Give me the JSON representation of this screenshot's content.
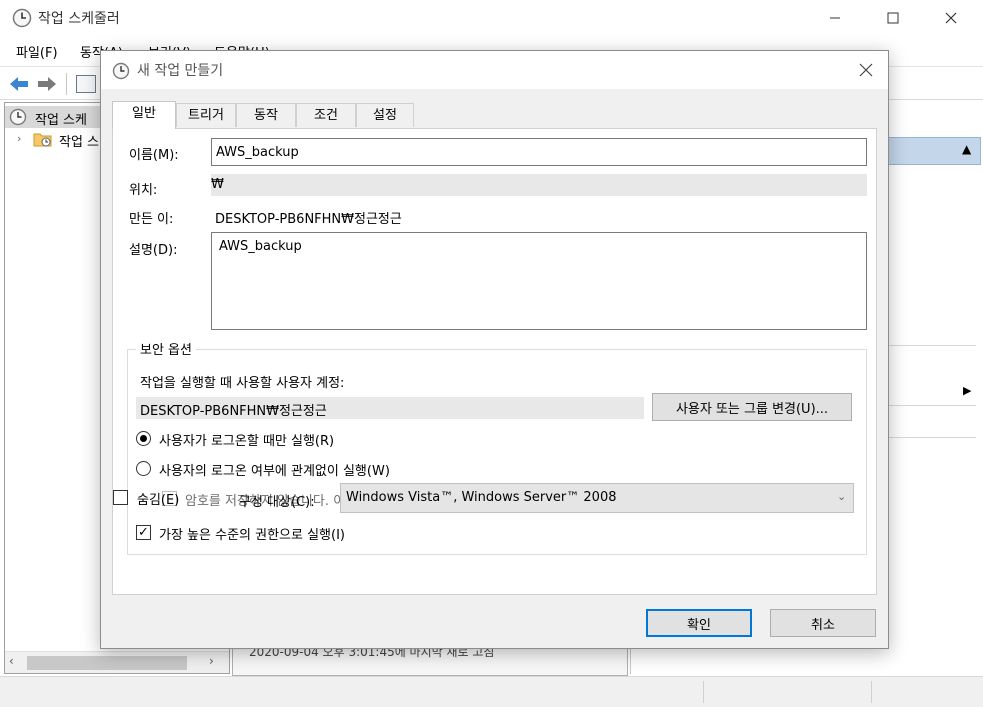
{
  "main_window": {
    "title": "작업 스케줄러",
    "menu": [
      "파일(F)",
      "동작(A)",
      "보기(V)",
      "도움말(H)"
    ],
    "tree": {
      "root_label": "작업 스케",
      "child_label": "작업 스"
    },
    "middle_bottom_text": "2020-09-04 오후 3:01:45에 마지막 새로 고침"
  },
  "dialog": {
    "title": "새 작업 만들기",
    "tabs": [
      "일반",
      "트리거",
      "동작",
      "조건",
      "설정"
    ],
    "general": {
      "name_label": "이름(M):",
      "name_value": "AWS_backup",
      "location_label": "위치:",
      "location_value": "₩",
      "author_label": "만든 이:",
      "author_value": "DESKTOP-PB6NFHN₩정근정근",
      "description_label": "설명(D):",
      "description_value": "AWS_backup",
      "security": {
        "title": "보안 옵션",
        "account_label": "작업을 실행할 때 사용할 사용자 계정:",
        "account_value": "DESKTOP-PB6NFHN₩정근정근",
        "change_button": "사용자 또는 그룹 변경(U)...",
        "radio_logon_only": "사용자가 로그온할 때만 실행(R)",
        "radio_always": "사용자의 로그온 여부에 관계없이 실행(W)",
        "no_password": "암호를 저장하지 않습니다. 이 작업에서는 로컬 컴퓨터 리소스에만 액세스할 수 있습니다(P).",
        "highest_privileges": "가장 높은 수준의 권한으로 실행(I)"
      },
      "hidden_label": "숨김(E)",
      "configure_label": "구성 대상(C):",
      "configure_value": "Windows Vista™, Windows Server™ 2008"
    },
    "buttons": {
      "ok": "확인",
      "cancel": "취소"
    }
  }
}
